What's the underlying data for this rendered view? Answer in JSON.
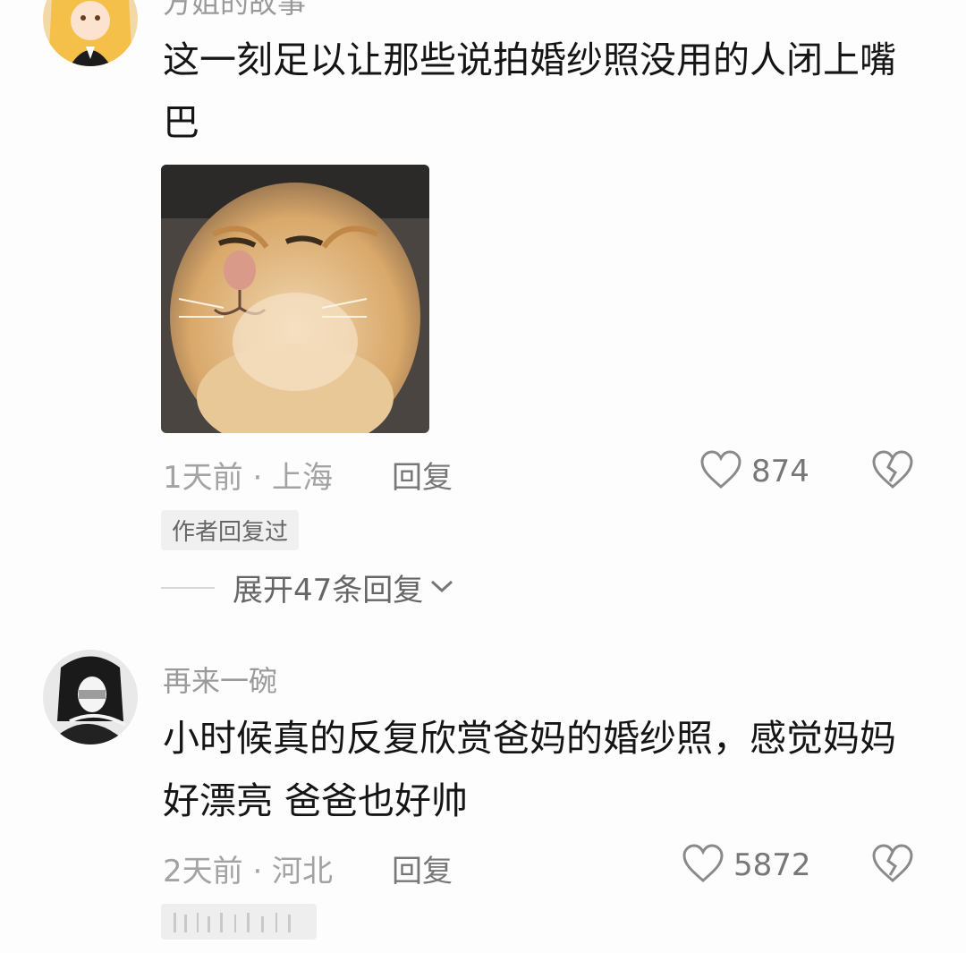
{
  "comments": [
    {
      "username": "方姐的故事",
      "text": "这一刻足以让那些说拍婚纱照没用的人闭上嘴巴",
      "time_location": "1天前 · 上海",
      "reply_label": "回复",
      "like_count": "874",
      "author_replied_tag": "作者回复过",
      "expand_replies_label": "展开47条回复",
      "has_image": true
    },
    {
      "username": "再来一碗",
      "text": "小时候真的反复欣赏爸妈的婚纱照，感觉妈妈好漂亮 爸爸也好帅",
      "time_location": "2天前 · 河北",
      "reply_label": "回复",
      "like_count": "5872",
      "has_image": false
    }
  ],
  "icons": {
    "like": "heart-outline-icon",
    "dislike": "broken-heart-icon",
    "expand": "chevron-down-icon"
  }
}
